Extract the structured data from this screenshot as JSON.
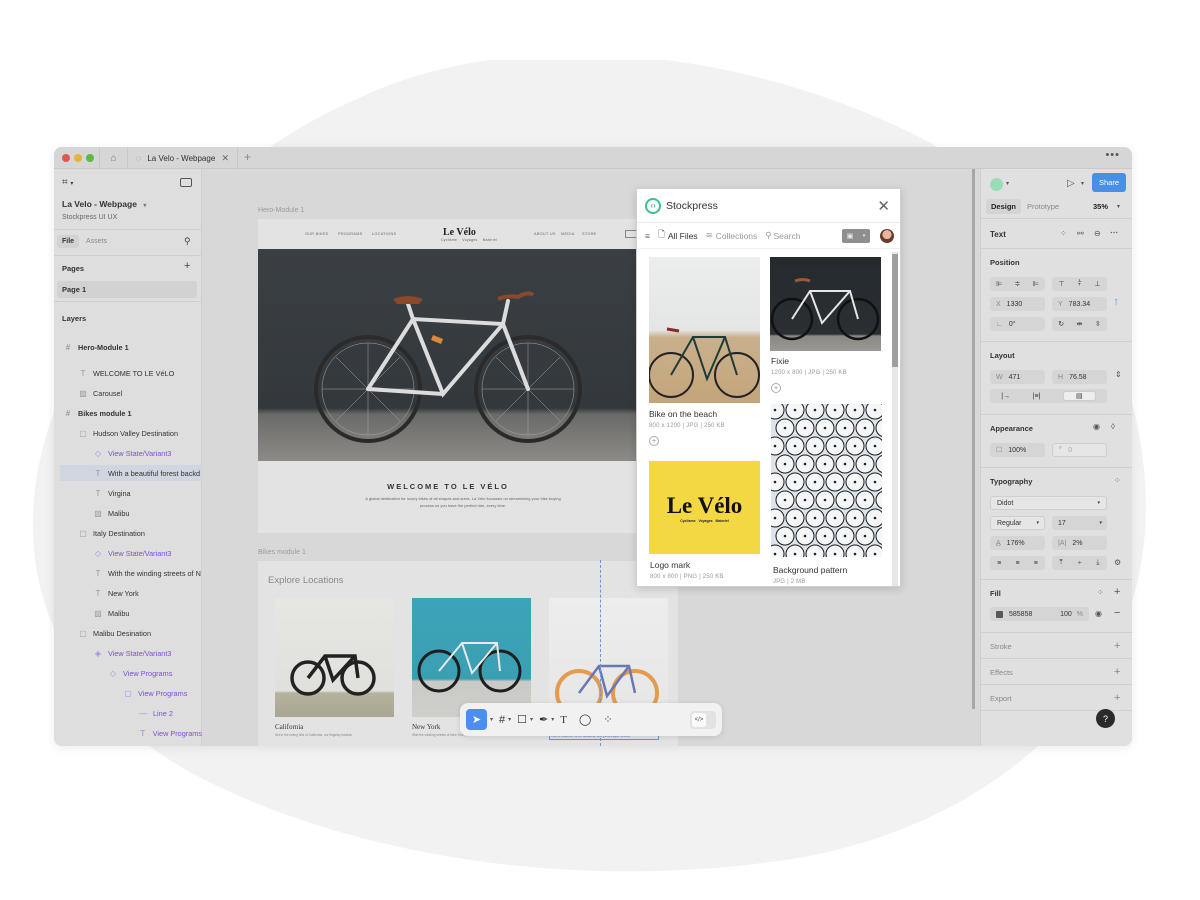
{
  "window": {
    "tab_title": "La Velo - Webpage",
    "more_label": "•••",
    "new_tab_label": "+"
  },
  "left_panel": {
    "file_name": "La Velo - Webpage",
    "team_name": "Stockpress UI UX",
    "tabs": [
      "File",
      "Assets"
    ],
    "pages_header": "Pages",
    "pages": [
      "Page 1"
    ],
    "layers_header": "Layers",
    "layers": [
      {
        "name": "Hero-Module 1",
        "icon": "frame-icon",
        "indent": 0,
        "style": "bold"
      },
      {
        "name": "WELCOME TO LE VéLO",
        "icon": "text-icon",
        "indent": 1,
        "style": "normal"
      },
      {
        "name": "Carousel",
        "icon": "image-icon",
        "indent": 1,
        "style": "normal"
      },
      {
        "name": "Bikes module 1",
        "icon": "frame-icon",
        "indent": 0,
        "style": "bold"
      },
      {
        "name": "Hudson Valley Destination",
        "icon": "group-icon",
        "indent": 1,
        "style": "normal"
      },
      {
        "name": "View State/Variant3",
        "icon": "component-instance-icon",
        "indent": 2,
        "style": "purple"
      },
      {
        "name": "With a beautiful forest backd",
        "icon": "text-icon",
        "indent": 2,
        "style": "selected"
      },
      {
        "name": "Virgina",
        "icon": "text-icon",
        "indent": 2,
        "style": "normal"
      },
      {
        "name": "Malibu",
        "icon": "image-icon",
        "indent": 2,
        "style": "normal"
      },
      {
        "name": "Italy Destination",
        "icon": "group-icon",
        "indent": 1,
        "style": "normal"
      },
      {
        "name": "View State/Variant3",
        "icon": "component-instance-icon",
        "indent": 2,
        "style": "purple"
      },
      {
        "name": "With the winding streets of N",
        "icon": "text-icon",
        "indent": 2,
        "style": "normal"
      },
      {
        "name": "New York",
        "icon": "text-icon",
        "indent": 2,
        "style": "normal"
      },
      {
        "name": "Malibu",
        "icon": "image-icon",
        "indent": 2,
        "style": "normal"
      },
      {
        "name": "Malibu Desination",
        "icon": "group-icon",
        "indent": 1,
        "style": "normal"
      },
      {
        "name": "View State/Variant3",
        "icon": "component-icon",
        "indent": 2,
        "style": "purple"
      },
      {
        "name": "View Programs",
        "icon": "component-instance-icon",
        "indent": 3,
        "style": "purple"
      },
      {
        "name": "View Programs",
        "icon": "group-icon",
        "indent": 4,
        "style": "purple"
      },
      {
        "name": "Line 2",
        "icon": "line-icon",
        "indent": 5,
        "style": "purple"
      },
      {
        "name": "View Programs",
        "icon": "text-icon",
        "indent": 5,
        "style": "purple"
      }
    ]
  },
  "canvas": {
    "hero_frame_label": "Hero-Module 1",
    "hero_nav_left": [
      "OUR BIKES",
      "PROGRAMS",
      "LOCATIONS"
    ],
    "hero_nav_right": [
      "ABOUT US",
      "MEDIA",
      "STORE"
    ],
    "hero_logo": "Le Vélo",
    "hero_logo_sub": "Cyclisme  Voyages  Materiel",
    "hero_title": "WELCOME TO LE VÉLO",
    "hero_text": "A global destination for luxury bikes of all shapes and sizes. La Vélo focusses on streamlining your bike buying process so you have the perfect ride, every time.",
    "bikes_frame_label": "Bikes module 1",
    "explore_title": "Explore Locations",
    "locations": [
      {
        "name": "California",
        "desc": "Set in the rolling hills of California, our flagship location"
      },
      {
        "name": "New York",
        "desc": "With the winding streets of New York, you'll need a bike to"
      },
      {
        "name": "",
        "desc": "With a beautiful forest backdrop and picturesque streets"
      }
    ]
  },
  "toolbar": {
    "tools": [
      "move-tool",
      "frame-tool",
      "shape-tool",
      "pen-tool",
      "text-tool",
      "comment-tool",
      "actions-tool"
    ],
    "dev_mode_label": "</>"
  },
  "stockpress": {
    "title": "Stockpress",
    "nav": {
      "all_files": "All Files",
      "collections": "Collections",
      "search": "Search"
    },
    "files": [
      {
        "title": "Bike on the beach",
        "meta": "800 x 1200  |  JPG  |  250 KB"
      },
      {
        "title": "Fixie",
        "meta": "1200 x 800  |  JPG  |  250 KB"
      },
      {
        "title": "Logo mark",
        "meta": "800 x 800  |  PNG  |  250 KB",
        "logo_text": "Le Vélo",
        "logo_sub": "Cyclisme   Voyages   Materiel"
      },
      {
        "title": "Background pattern",
        "meta": "JPG  |  2 MB"
      }
    ]
  },
  "right_panel": {
    "share_label": "Share",
    "tabs": [
      "Design",
      "Prototype"
    ],
    "zoom": "35%",
    "selection_type": "Text",
    "position": {
      "header": "Position",
      "x_label": "X",
      "x": "1330",
      "y_label": "Y",
      "y": "783.34",
      "rotation": "0°"
    },
    "layout": {
      "header": "Layout",
      "w_label": "W",
      "w": "471",
      "h_label": "H",
      "h": "76.58"
    },
    "appearance": {
      "header": "Appearance",
      "opacity": "100%",
      "radius": "0"
    },
    "typography": {
      "header": "Typography",
      "font": "Didot",
      "weight": "Regular",
      "size": "17",
      "line_height": "176%",
      "letter_spacing": "2%"
    },
    "fill": {
      "header": "Fill",
      "hex": "585858",
      "opacity": "100",
      "percent": "%",
      "color": "#585858"
    },
    "stroke_header": "Stroke",
    "effects_header": "Effects",
    "export_header": "Export",
    "help_label": "?"
  },
  "colors": {
    "accent": "#4a8fe6",
    "purple": "#7b4fd8",
    "stockpress_green": "#3cc18e",
    "logo_yellow": "#f3d743"
  }
}
